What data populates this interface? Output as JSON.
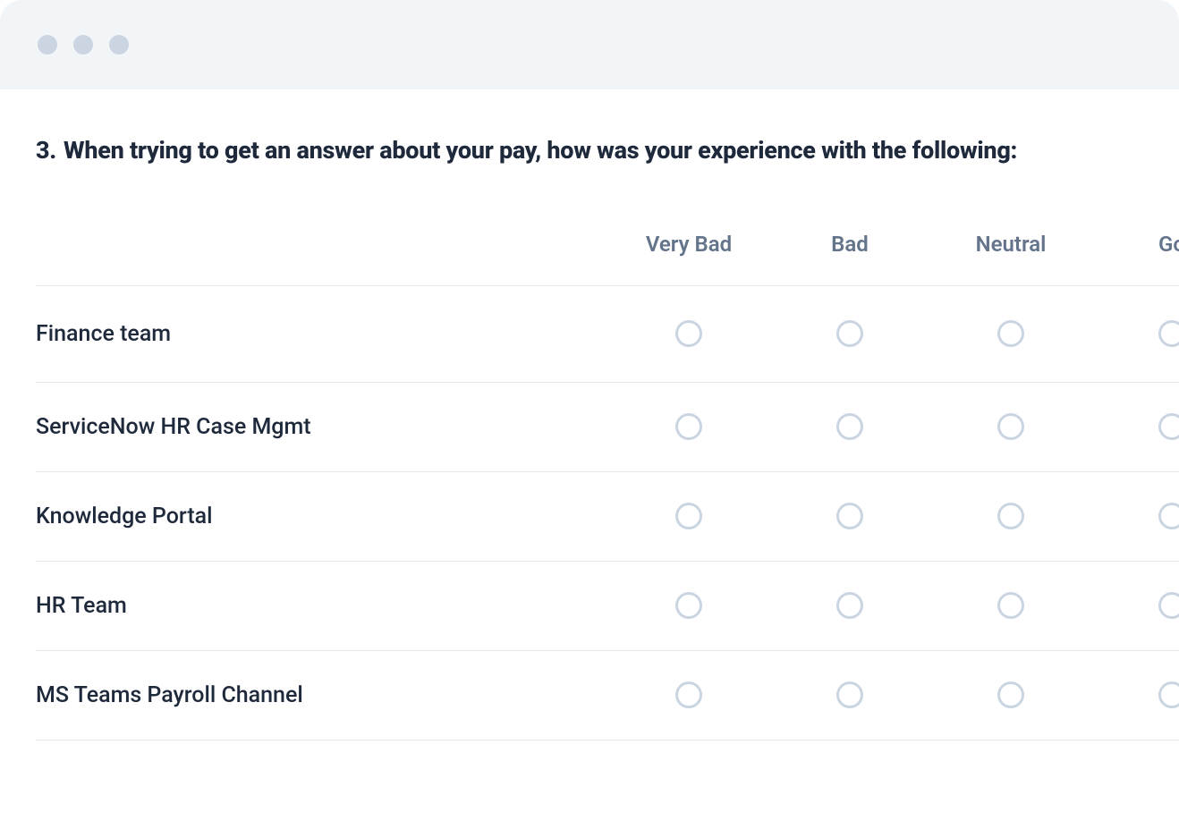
{
  "question": {
    "number": "3.",
    "text": "When trying to get an answer about your pay, how was your experience with the following:"
  },
  "columns": [
    "Very Bad",
    "Bad",
    "Neutral",
    "Go"
  ],
  "rows": [
    {
      "label": "Finance team"
    },
    {
      "label": "ServiceNow HR Case Mgmt"
    },
    {
      "label": "Knowledge Portal"
    },
    {
      "label": "HR Team"
    },
    {
      "label": "MS Teams Payroll Channel"
    }
  ]
}
